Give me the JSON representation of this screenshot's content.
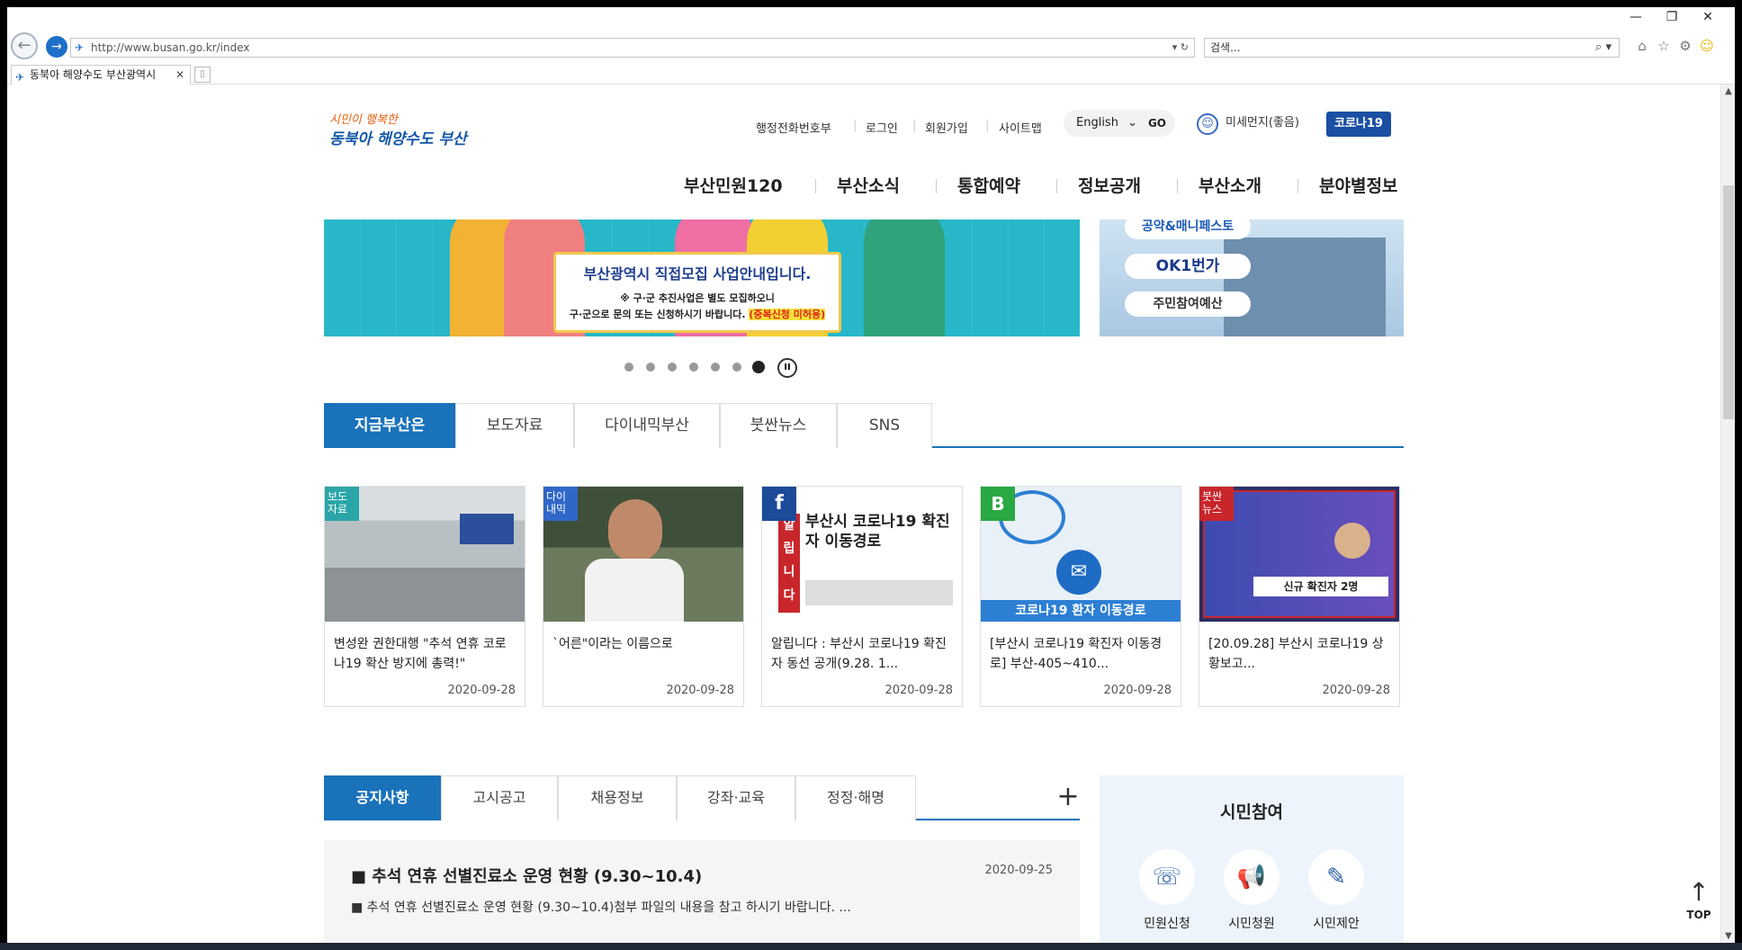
{
  "browser": {
    "url": "http://www.busan.go.kr/index",
    "search_placeholder": "검색...",
    "tab_title": "동북아 해양수도 부산광역시",
    "window_controls": [
      "minimize-icon",
      "restore-icon",
      "close-icon"
    ]
  },
  "header": {
    "logo_line1": "시민이 행복한",
    "logo_line2": "동북아 해양수도 부산",
    "util_links": [
      "행정전화번호부",
      "로그인",
      "회원가입",
      "사이트맵"
    ],
    "language": "English",
    "go_label": "GO",
    "dust_label": "미세먼지(좋음)",
    "corona_label": "코로나19"
  },
  "gnb": [
    "부산민원120",
    "부산소식",
    "통합예약",
    "정보공개",
    "부산소개",
    "분야별정보"
  ],
  "banner": {
    "headline": "부산광역시 직접모집 사업안내입니다.",
    "line2": "※ 구·군 추진사업은 별도 모집하오니",
    "line3": "구·군으로 문의 또는 신청하시기 바랍니다.",
    "highlight": "(중복신청 미허용)"
  },
  "side_banner": {
    "pills": [
      "공약&매니페스토",
      "OK1번가",
      "주민참여예산"
    ]
  },
  "slider": {
    "total_dots": 7,
    "active_index": 6
  },
  "news_tabs": [
    "지금부산은",
    "보도자료",
    "다이내믹부산",
    "붓싼뉴스",
    "SNS"
  ],
  "news_cards": [
    {
      "tag": "보도\n자료",
      "tag_color": "#2aa6a8",
      "title": "변성완 권한대행 \"추석 연휴 코로나19 확산 방지에 총력!\"",
      "date": "2020-09-28"
    },
    {
      "tag": "다이\n내믹",
      "tag_color": "#2f67c9",
      "title": "`어른\"이라는 이름으로",
      "date": "2020-09-28"
    },
    {
      "tag": "f",
      "tag_color": "#1e4a9a",
      "title": "알립니다 : 부산시 코로나19 확진자 동선 공개(9.28. 1...",
      "date": "2020-09-28",
      "image_text": "부산시 코로나19 확진자 이동경로",
      "image_side": "알립니다"
    },
    {
      "tag": "B",
      "tag_color": "#2aa844",
      "title": "[부산시 코로나19 확진자 이동경로] 부산-405~410...",
      "date": "2020-09-28",
      "image_text": "코로나19 환자 이동경로"
    },
    {
      "tag": "붓싼\n뉴스",
      "tag_color": "#c8262b",
      "title": "[20.09.28] 부산시 코로나19 상황보고...",
      "date": "2020-09-28",
      "image_text": "신규 확진자 2명"
    }
  ],
  "notice_tabs": [
    "공지사항",
    "고시공고",
    "채용정보",
    "강좌·교육",
    "정정·해명"
  ],
  "notice": {
    "title": "■ 추석 연휴 선별진료소 운영 현황 (9.30~10.4)",
    "date": "2020-09-25",
    "excerpt": "■ 추석 연휴 선별진료소 운영 현황 (9.30~10.4)첨부 파일의 내용을 참고 하시기 바랍니다. ..."
  },
  "civic": {
    "title": "시민참여",
    "items": [
      {
        "label": "민원신청",
        "icon": "person-chat-icon"
      },
      {
        "label": "시민청원",
        "icon": "megaphone-icon"
      },
      {
        "label": "시민제안",
        "icon": "document-pen-icon"
      }
    ]
  },
  "top_label": "TOP"
}
